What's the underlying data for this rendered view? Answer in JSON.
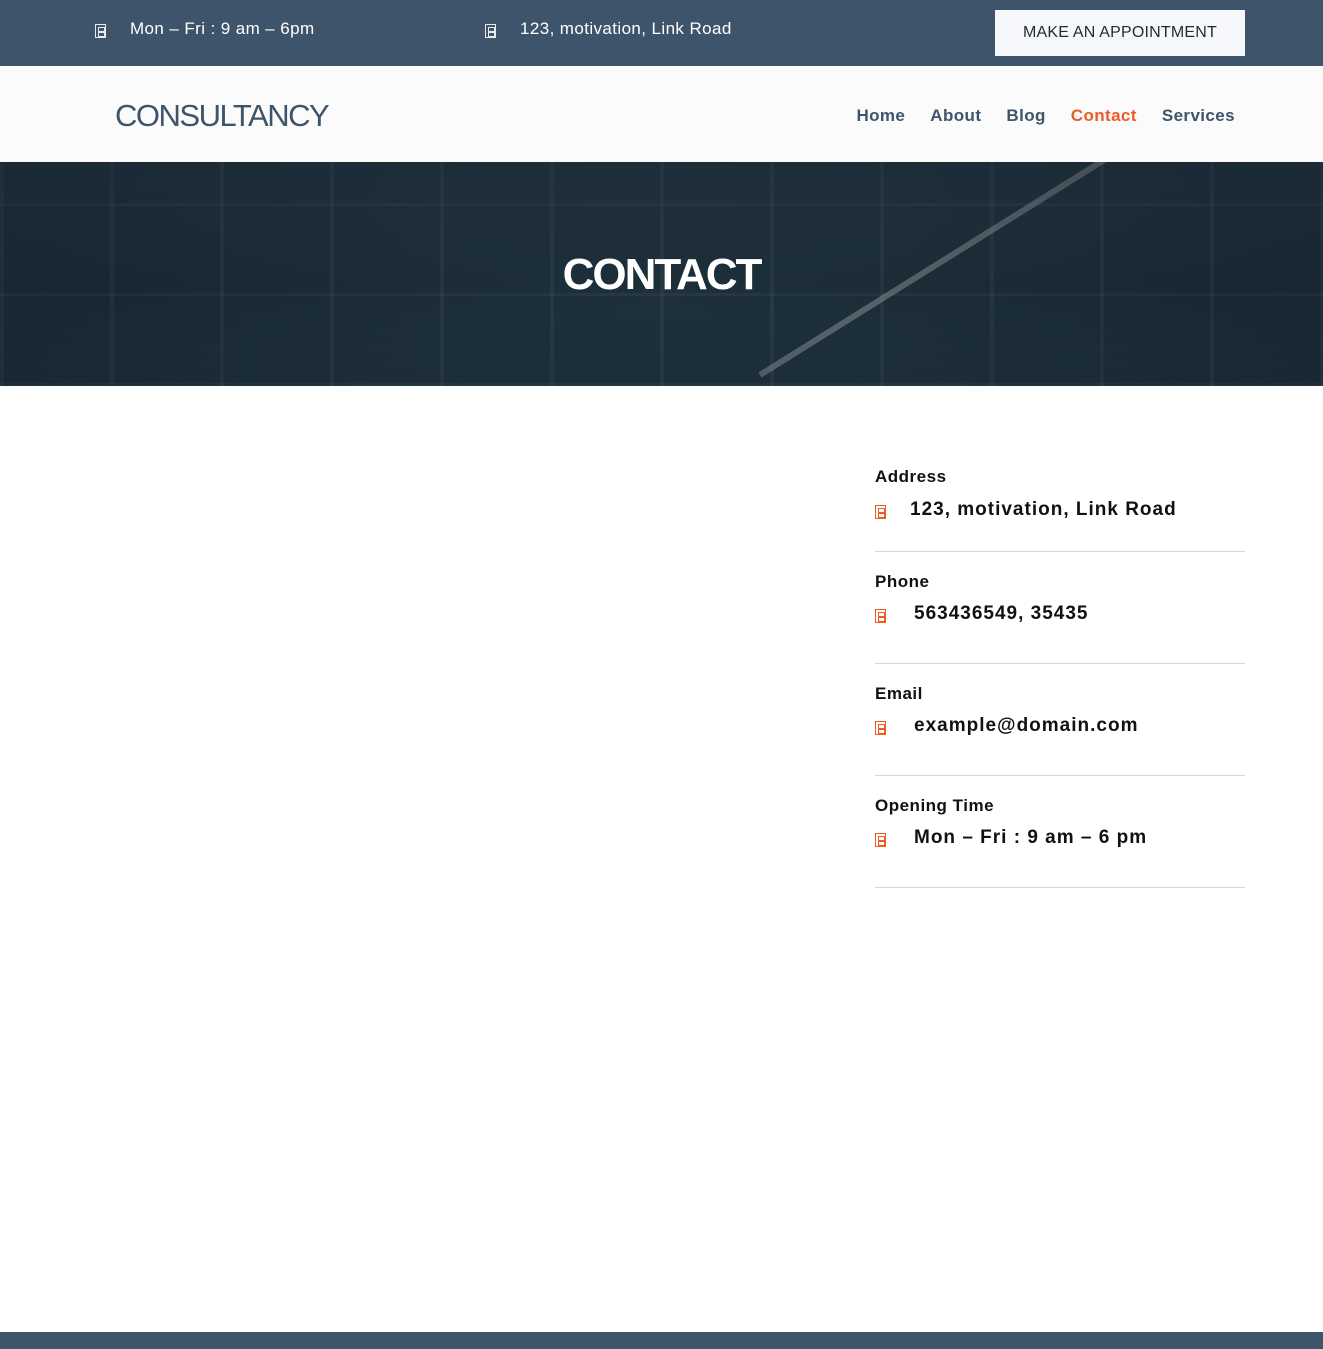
{
  "topbar": {
    "hours": "Mon – Fri : 9 am – 6pm",
    "address": "123, motivation, Link Road",
    "appointment_label": "MAKE AN APPOINTMENT"
  },
  "header": {
    "logo": "CONSULTANCY",
    "nav": [
      {
        "label": "Home"
      },
      {
        "label": "About"
      },
      {
        "label": "Blog"
      },
      {
        "label": "Contact",
        "active": true
      },
      {
        "label": "Services"
      }
    ]
  },
  "hero": {
    "title": "CONTACT"
  },
  "contact_info": {
    "address": {
      "label": "Address",
      "value": "123, motivation, Link Road"
    },
    "phone": {
      "label": "Phone",
      "value": "563436549, 35435"
    },
    "email": {
      "label": "Email",
      "value": "example@domain.com"
    },
    "opening": {
      "label": "Opening Time",
      "value": "Mon – Fri : 9 am – 6 pm"
    }
  },
  "colors": {
    "primary": "#3e546b",
    "accent": "#ee5a24",
    "text": "#111111"
  },
  "icons": {
    "hours": "clock-icon",
    "address": "location-icon",
    "phone": "phone-icon",
    "email": "envelope-icon",
    "opening": "clock-icon"
  }
}
